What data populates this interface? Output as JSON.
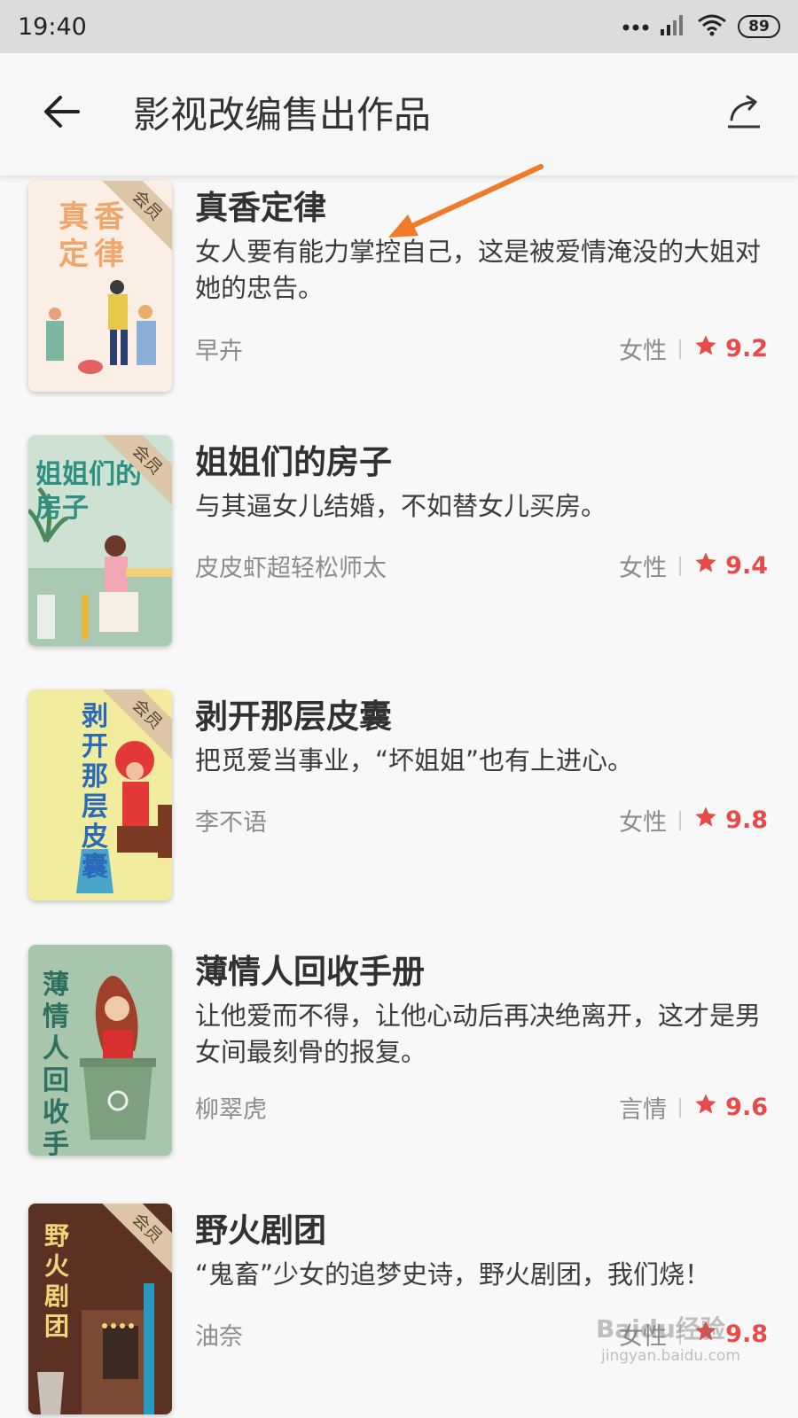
{
  "status_bar": {
    "time": "19:40",
    "battery": "89",
    "icons": [
      "more-dots-icon",
      "signal-icon",
      "wifi-icon",
      "battery-icon"
    ]
  },
  "app_bar": {
    "title": "影视改编售出作品",
    "back_icon": "back-arrow-icon",
    "share_icon": "share-icon"
  },
  "books": [
    {
      "title": "真香定律",
      "description": "女人要有能力掌控自己，这是被爱情淹没的大姐对她的忠告。",
      "author": "早卉",
      "genre": "女性",
      "rating": "9.2",
      "badge": "会员",
      "cover_text": "真香定律"
    },
    {
      "title": "姐姐们的房子",
      "description": "与其逼女儿结婚，不如替女儿买房。",
      "author": "皮皮虾超轻松师太",
      "genre": "女性",
      "rating": "9.4",
      "badge": "会员",
      "cover_text": "姐姐们的房子"
    },
    {
      "title": "剥开那层皮囊",
      "description": "把觅爱当事业，“坏姐姐”也有上进心。",
      "author": "李不语",
      "genre": "女性",
      "rating": "9.8",
      "badge": "会员",
      "cover_text": "剥开那层皮囊"
    },
    {
      "title": "薄情人回收手册",
      "description": "让他爱而不得，让他心动后再决绝离开，这才是男女间最刻骨的报复。",
      "author": "柳翠虎",
      "genre": "言情",
      "rating": "9.6",
      "badge": "",
      "cover_text": "薄情人回收手册"
    },
    {
      "title": "野火剧团",
      "description": "“鬼畜”少女的追梦史诗，野火剧团，我们烧！",
      "author": "油奈",
      "genre": "女性",
      "rating": "9.8",
      "badge": "会员",
      "cover_text": "野火剧团"
    }
  ],
  "colors": {
    "rating": "#e84a4a",
    "status_bar": "#dcdcdc",
    "annotation_arrow": "#f07a2a",
    "member_badge": "#dec7a6"
  },
  "watermark": {
    "text": "Baidu经验",
    "url": "jingyan.baidu.com"
  }
}
